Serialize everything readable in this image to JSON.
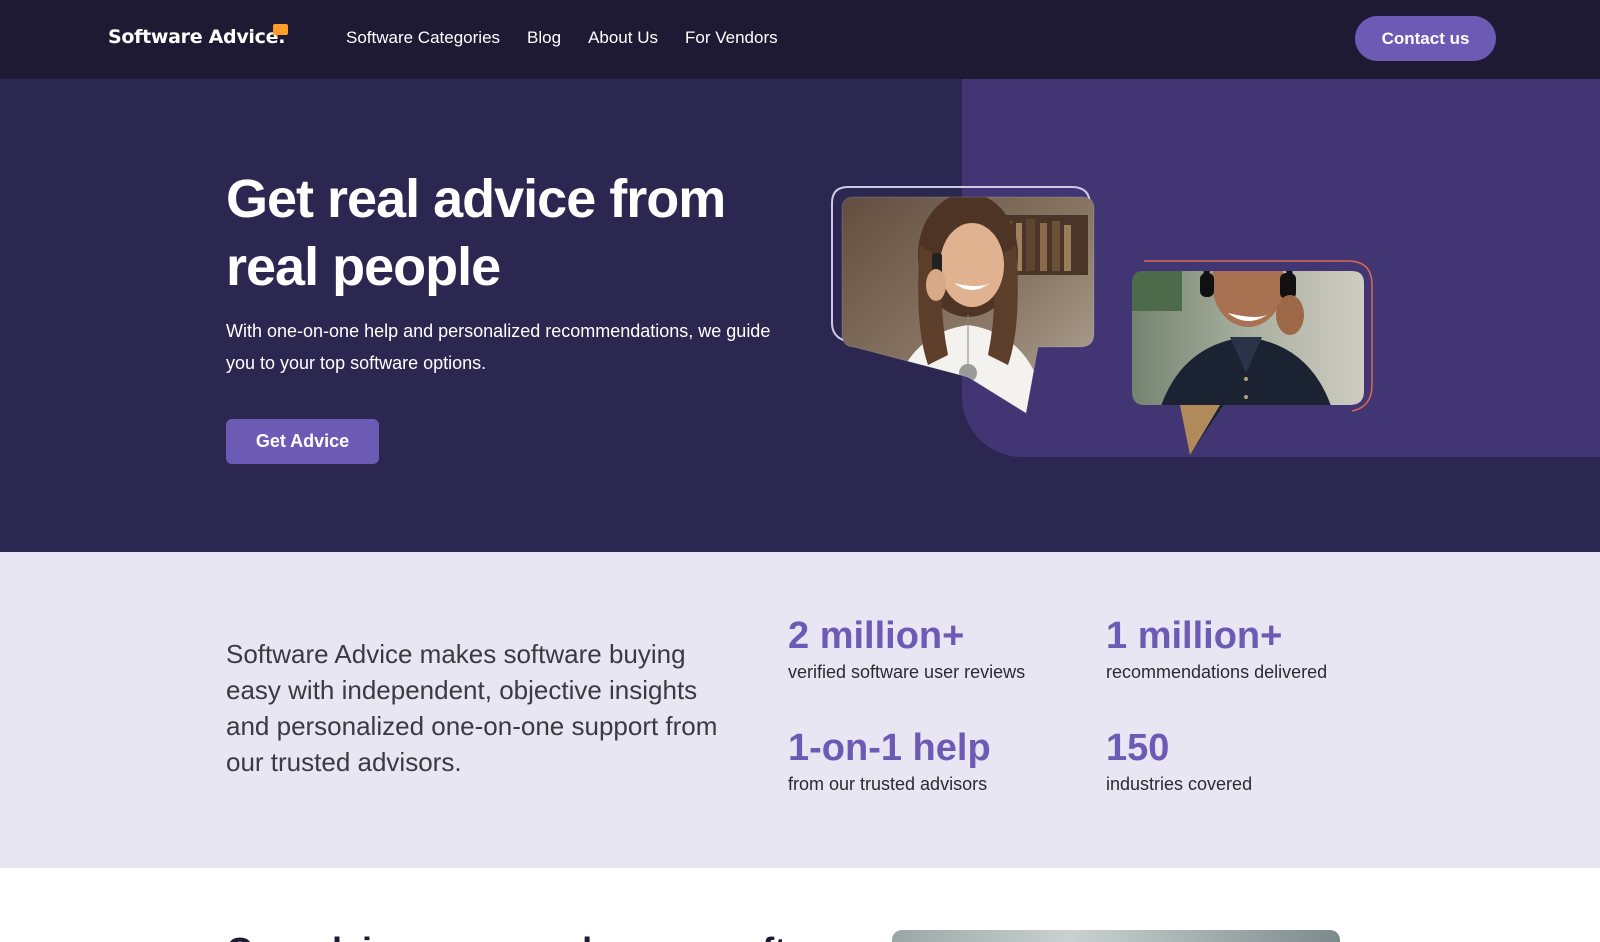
{
  "nav": {
    "logo_text": "Software Advice",
    "links": [
      "Software Categories",
      "Blog",
      "About Us",
      "For Vendors"
    ],
    "contact_label": "Contact us"
  },
  "hero": {
    "title": "Get real advice from real people",
    "subtitle": "With one-on-one help and personalized recommendations, we guide you to your top software options.",
    "cta_label": "Get Advice"
  },
  "stats": {
    "intro": "Software Advice makes software buying easy with independent, objective insights and personalized one-on-one support from our trusted advisors.",
    "items": [
      {
        "value": "2 million+",
        "label": "verified software user reviews"
      },
      {
        "value": "1 million+",
        "label": "recommendations delivered"
      },
      {
        "value": "1-on-1 help",
        "label": "from our trusted advisors"
      },
      {
        "value": "150",
        "label": "industries covered"
      }
    ]
  },
  "next_section": {
    "heading_partial": "Our advisors can make your soft"
  },
  "colors": {
    "nav_bg": "#1e1a33",
    "hero_bg": "#2c2750",
    "hero_panel": "#413673",
    "accent": "#6b5bb5",
    "logo_bubble": "#ff9d28",
    "stats_bg": "#e8e6f3"
  }
}
